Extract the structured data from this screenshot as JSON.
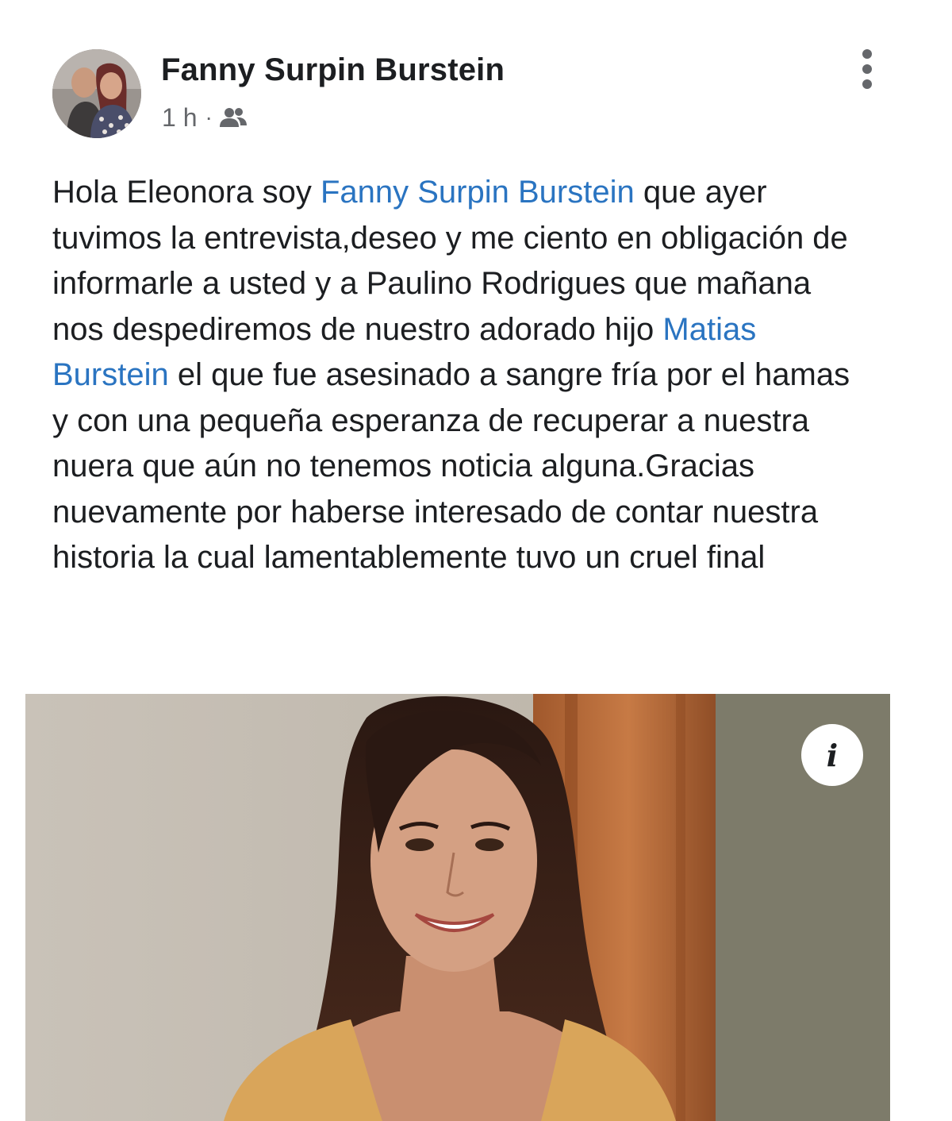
{
  "post": {
    "author_name": "Fanny Surpin Burstein",
    "timestamp": "1 h",
    "separator": "·",
    "audience_icon": "friends-icon",
    "more_icon": "more-vertical-icon",
    "body": {
      "text_1": "Hola Eleonora soy ",
      "mention_1": "Fanny Surpin Burstein",
      "text_2": " que ayer tuvimos la entrevista,deseo y me ciento en obligación de informarle a usted y a Paulino Rodrigues que mañana nos despediremos de nuestro adorado hijo ",
      "mention_2": "Matias Burstein",
      "text_3": " el que fue asesinado a sangre fría por el hamas y con una pequeña esperanza de recuperar a nuestra nuera que aún no tenemos noticia alguna.Gracias nuevamente por haberse interesado de contar nuestra historia la cual lamentablemente tuvo un cruel final"
    },
    "photo": {
      "info_icon": "info-icon",
      "info_glyph": "i"
    }
  },
  "colors": {
    "text": "#1c1e21",
    "secondary_text": "#65676b",
    "mention_link": "#2a74c1",
    "background": "#ffffff"
  }
}
